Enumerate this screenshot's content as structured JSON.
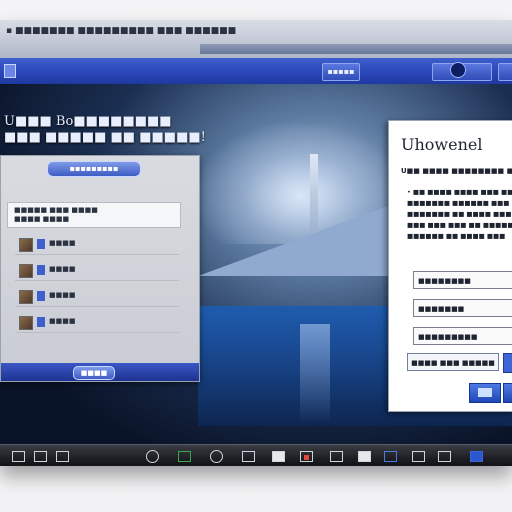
{
  "window": {
    "title": "▪ ■■■■■■■ ■■■■■■■■■ ■■■ ■■■■■■",
    "menubar": {
      "left_button": "",
      "center_button": "▪▪▪▪▪",
      "right_button": "▪▪▪"
    }
  },
  "desktop": {
    "title_line1": "U■■■ Bo■■■■■■■■",
    "title_line2": "■■■ ■■■■■ ■■ ■■■■■!"
  },
  "left_dialog": {
    "header": "▪▪▪▪▪▪▪▪▪",
    "panel_text_1": "■■■■■ ■■■ ■■■■",
    "panel_text_2": "■■■■ ■■■■",
    "rows": [
      {
        "label": "■■■■"
      },
      {
        "label": "■■■■"
      },
      {
        "label": "■■■■"
      },
      {
        "label": "■■■■"
      }
    ],
    "footer_button": "■■■■"
  },
  "right_dialog": {
    "title": "Uhowenel",
    "subtitle": "U■■ ■■■■ ■■■■■■■■ ■■■",
    "lines": [
      "• ■■ ■■■■ ■■■■ ■■■ ■■■",
      "■■■■■■■ ■■■■■■ ■■■",
      "■■■■■■■ ■■ ■■■■ ■■■",
      "■■■ ■■■ ■■■ ■■ ■■■■■■",
      "■■■■■■ ■■ ■■■■ ■■■"
    ],
    "field_1": "■■■■■■■■",
    "field_2": "■■■■■■■",
    "field_3": "■■■■■■■■■",
    "link_button": "■■■■ ■■■ ■■■■■",
    "accent_color": "#3d65d6"
  },
  "taskbar": {
    "icons": [
      "start-icon",
      "window-icon",
      "folder-icon",
      "app-icon",
      "circle-icon",
      "monitor-icon",
      "box-icon",
      "image-icon",
      "app-icon-2",
      "folder-icon-2",
      "monitor-icon-2",
      "window-icon-2",
      "app-icon-3"
    ]
  }
}
